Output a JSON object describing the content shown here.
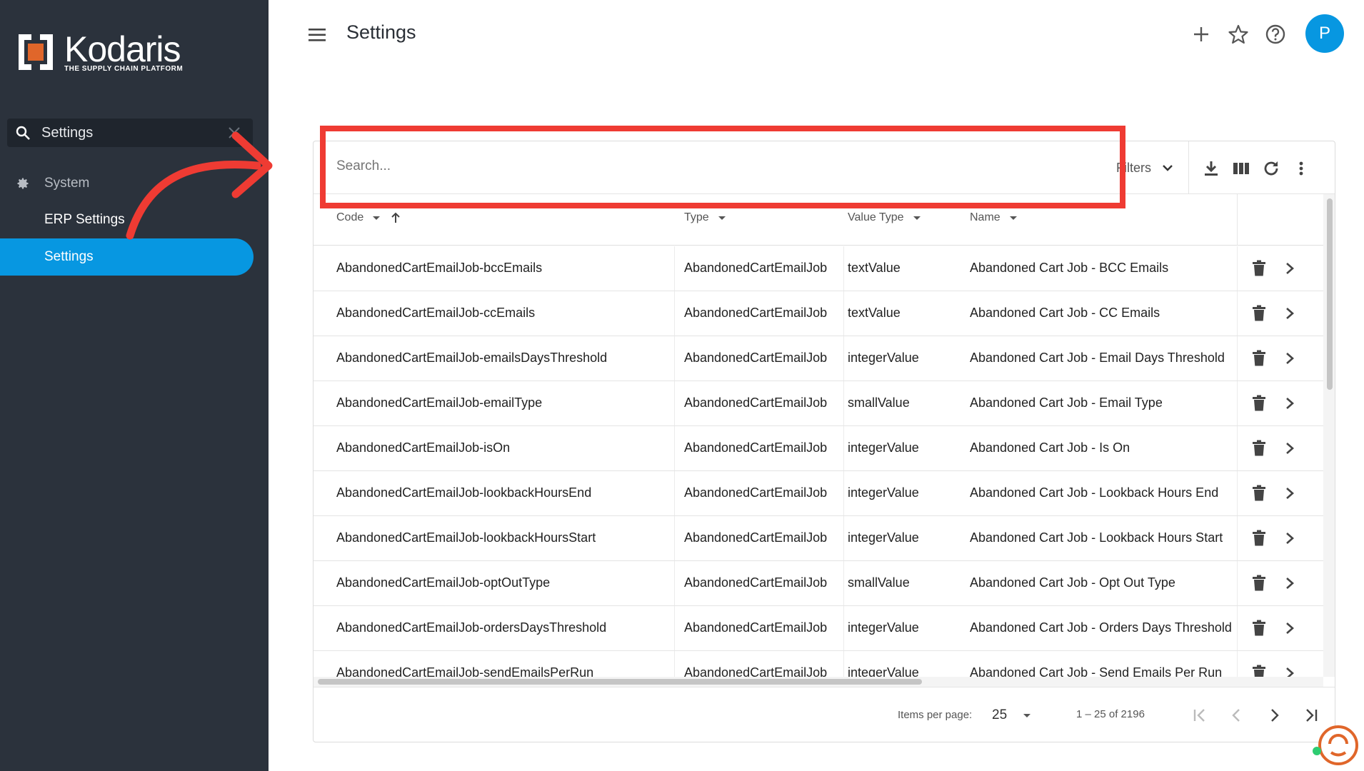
{
  "app": {
    "logo_word": "Kodaris",
    "logo_tagline": "THE SUPPLY CHAIN PLATFORM"
  },
  "sidebar": {
    "search_value": "Settings",
    "group_label": "System",
    "items": [
      {
        "label": "ERP Settings",
        "active": false
      },
      {
        "label": "Settings",
        "active": true
      }
    ]
  },
  "header": {
    "title": "Settings",
    "avatar_initial": "P"
  },
  "toolbar": {
    "search_placeholder": "Search...",
    "filters_label": "Filters"
  },
  "table": {
    "columns": [
      "Code",
      "Type",
      "Value Type",
      "Name"
    ],
    "rows": [
      {
        "code": "AbandonedCartEmailJob-bccEmails",
        "type": "AbandonedCartEmailJob",
        "value_type": "textValue",
        "name": "Abandoned Cart Job - BCC Emails"
      },
      {
        "code": "AbandonedCartEmailJob-ccEmails",
        "type": "AbandonedCartEmailJob",
        "value_type": "textValue",
        "name": "Abandoned Cart Job - CC Emails"
      },
      {
        "code": "AbandonedCartEmailJob-emailsDaysThreshold",
        "type": "AbandonedCartEmailJob",
        "value_type": "integerValue",
        "name": "Abandoned Cart Job - Email Days Threshold"
      },
      {
        "code": "AbandonedCartEmailJob-emailType",
        "type": "AbandonedCartEmailJob",
        "value_type": "smallValue",
        "name": "Abandoned Cart Job - Email Type"
      },
      {
        "code": "AbandonedCartEmailJob-isOn",
        "type": "AbandonedCartEmailJob",
        "value_type": "integerValue",
        "name": "Abandoned Cart Job - Is On"
      },
      {
        "code": "AbandonedCartEmailJob-lookbackHoursEnd",
        "type": "AbandonedCartEmailJob",
        "value_type": "integerValue",
        "name": "Abandoned Cart Job - Lookback Hours End"
      },
      {
        "code": "AbandonedCartEmailJob-lookbackHoursStart",
        "type": "AbandonedCartEmailJob",
        "value_type": "integerValue",
        "name": "Abandoned Cart Job - Lookback Hours Start"
      },
      {
        "code": "AbandonedCartEmailJob-optOutType",
        "type": "AbandonedCartEmailJob",
        "value_type": "smallValue",
        "name": "Abandoned Cart Job - Opt Out Type"
      },
      {
        "code": "AbandonedCartEmailJob-ordersDaysThreshold",
        "type": "AbandonedCartEmailJob",
        "value_type": "integerValue",
        "name": "Abandoned Cart Job - Orders Days Threshold"
      },
      {
        "code": "AbandonedCartEmailJob-sendEmailsPerRun",
        "type": "AbandonedCartEmailJob",
        "value_type": "integerValue",
        "name": "Abandoned Cart Job - Send Emails Per Run"
      }
    ]
  },
  "paginator": {
    "items_per_page_label": "Items per page:",
    "items_per_page": "25",
    "range_label": "1 – 25 of 2196"
  },
  "colors": {
    "sidebar_bg": "#2b323c",
    "accent": "#0797e1",
    "annotation_red": "#ef3b33",
    "logo_orange": "#e0662a"
  },
  "icons": [
    "search-icon",
    "close-icon",
    "gear-icon",
    "menu-icon",
    "add-icon",
    "star-icon",
    "help-icon",
    "download-icon",
    "columns-icon",
    "refresh-icon",
    "more-vert-icon",
    "sort-down-icon",
    "sort-up-icon",
    "delete-icon",
    "chevron-right-icon",
    "first-page-icon",
    "prev-page-icon",
    "next-page-icon",
    "last-page-icon",
    "chat-icon"
  ]
}
